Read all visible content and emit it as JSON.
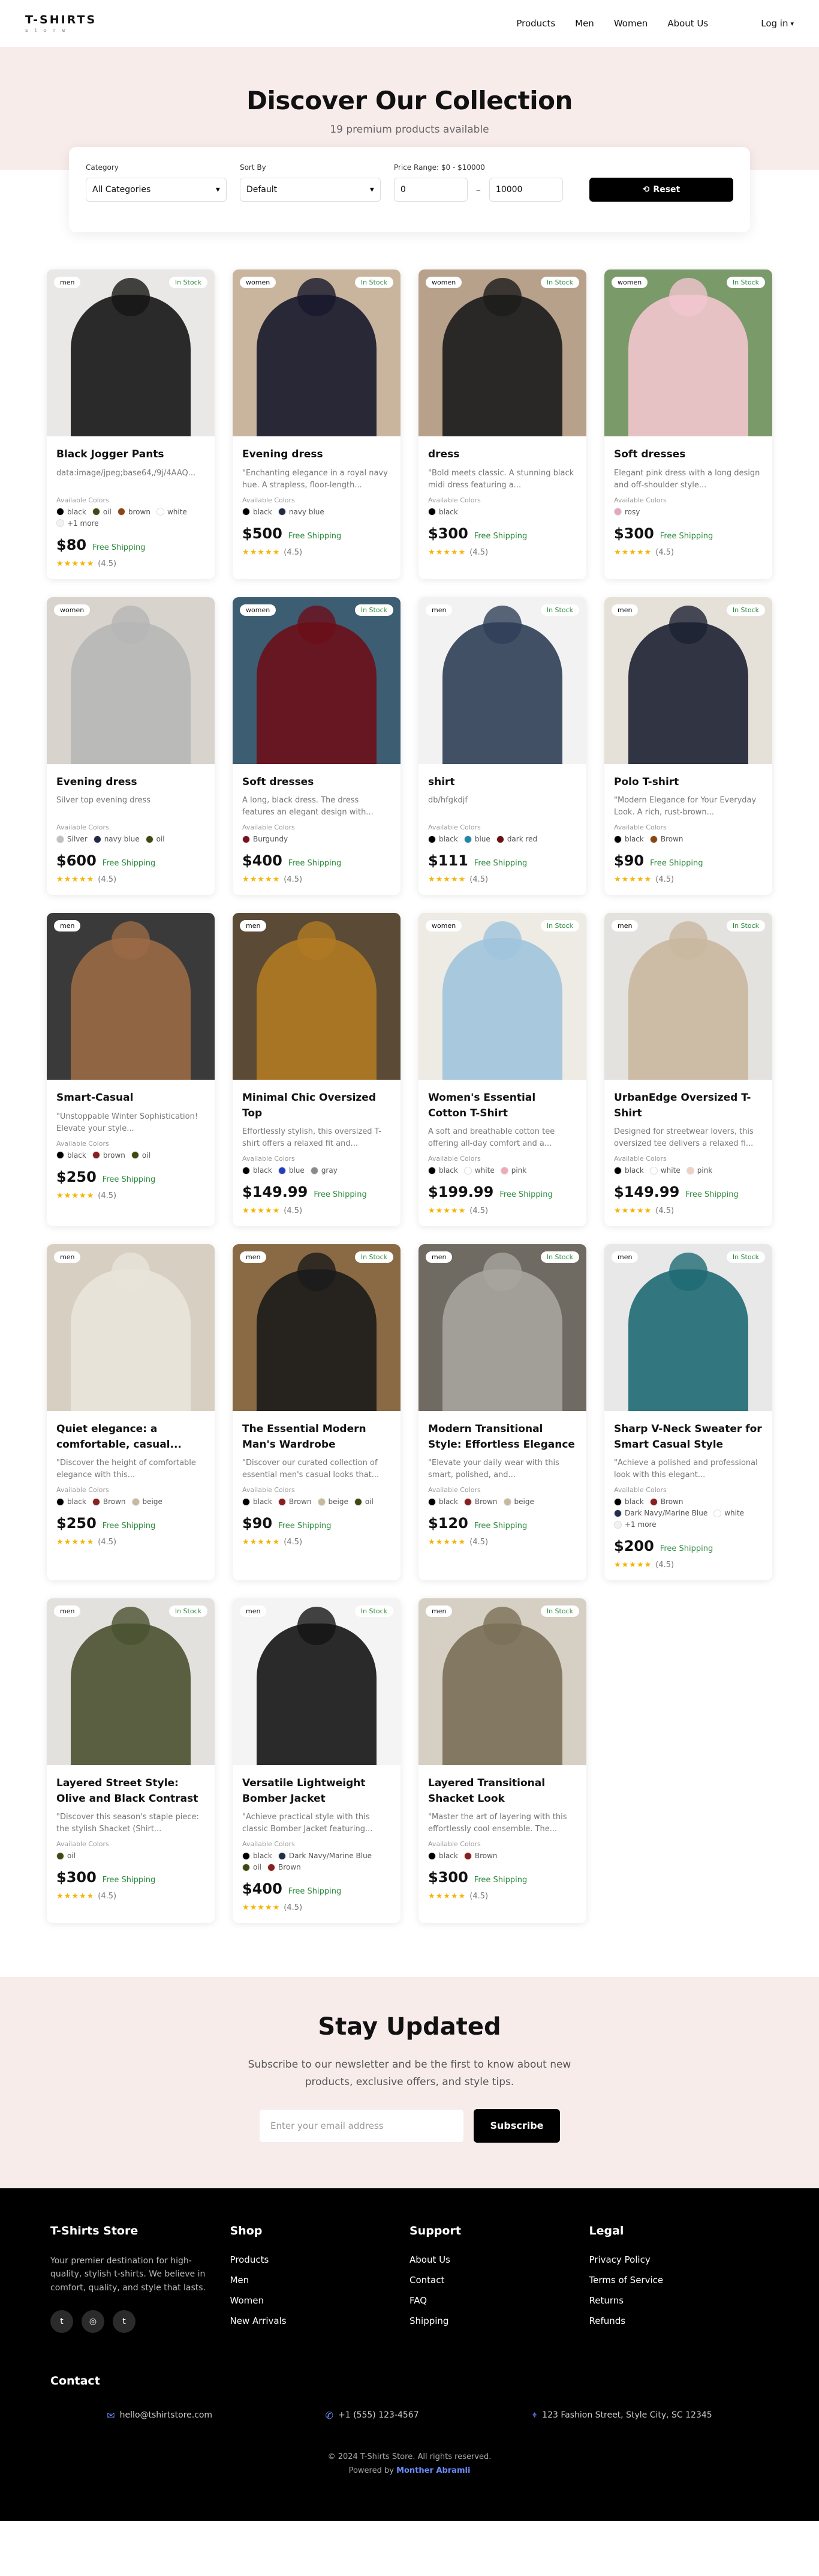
{
  "header": {
    "logo": "T-SHIRTS",
    "logo_sub": "store",
    "nav": [
      "Products",
      "Men",
      "Women",
      "About Us"
    ],
    "login": "Log in"
  },
  "hero": {
    "title": "Discover Our Collection",
    "subtitle": "19 premium products available"
  },
  "filters": {
    "category_label": "Category",
    "category_value": "All Categories",
    "sort_label": "Sort By",
    "sort_value": "Default",
    "price_label": "Price Range: $0 - $10000",
    "price_min": "0",
    "price_max": "10000",
    "reset_label": "Reset"
  },
  "labels": {
    "available_colors": "Available Colors",
    "free_shipping": "Free Shipping",
    "rating": "(4.5)"
  },
  "products": [
    {
      "cat": "men",
      "stock": "In Stock",
      "title": "Black Jogger Pants",
      "desc": "data:image/jpeg;base64,/9j/4AAQ...",
      "colors": [
        [
          "black",
          "#000000"
        ],
        [
          "oil",
          "#3f4a12"
        ],
        [
          "brown",
          "#8b4513"
        ],
        [
          "white",
          "#ffffff"
        ]
      ],
      "more": "+1 more",
      "price": "$80",
      "bg": "#e9e8e6",
      "fg": "#151515"
    },
    {
      "cat": "women",
      "stock": "In Stock",
      "title": "Evening dress",
      "desc": "\"Enchanting elegance in a royal navy hue. A strapless, floor-length...",
      "colors": [
        [
          "black",
          "#000000"
        ],
        [
          "navy blue",
          "#1f2a44"
        ]
      ],
      "price": "$500",
      "bg": "#c9b59d",
      "fg": "#16182c"
    },
    {
      "cat": "women",
      "stock": "In Stock",
      "title": "dress",
      "desc": "\"Bold meets classic. A stunning black midi dress featuring a...",
      "colors": [
        [
          "black",
          "#000000"
        ]
      ],
      "price": "$300",
      "bg": "#b7a18b",
      "fg": "#1b1b1b"
    },
    {
      "cat": "women",
      "stock": "In Stock",
      "title": "Soft dresses",
      "desc": "Elegant pink dress with a long design and off-shoulder style...",
      "colors": [
        [
          "rosy",
          "#e6a5c3"
        ]
      ],
      "price": "$300",
      "bg": "#7a9a6a",
      "fg": "#f3c6cf"
    },
    {
      "cat": "women",
      "stock": "",
      "title": "Evening dress",
      "desc": "Silver top evening dress",
      "colors": [
        [
          "Silver",
          "#c0c0c0"
        ],
        [
          "navy blue",
          "#1f2a44"
        ],
        [
          "oil",
          "#3f4a12"
        ]
      ],
      "price": "$600",
      "bg": "#d8d3cd",
      "fg": "#b7b7b7"
    },
    {
      "cat": "women",
      "stock": "In Stock",
      "title": "Soft dresses",
      "desc": "A long, black dress. The dress features an elegant design with...",
      "colors": [
        [
          "Burgundy",
          "#7a0f1f"
        ]
      ],
      "price": "$400",
      "bg": "#3c5d72",
      "fg": "#6b0f1a"
    },
    {
      "cat": "men",
      "stock": "In Stock",
      "title": "shirt",
      "desc": "db/hfgkdjf",
      "colors": [
        [
          "black",
          "#000000"
        ],
        [
          "blue",
          "#1e88a8"
        ],
        [
          "dark red",
          "#6b0f0f"
        ]
      ],
      "price": "$111",
      "bg": "#f2f2f2",
      "fg": "#2f3e57"
    },
    {
      "cat": "men",
      "stock": "In Stock",
      "title": "Polo T-shirt",
      "desc": "\"Modern Elegance for Your Everyday Look. A rich, rust-brown...",
      "colors": [
        [
          "black",
          "#000000"
        ],
        [
          "Brown",
          "#8b4513"
        ]
      ],
      "price": "$90",
      "bg": "#e6e1d8",
      "fg": "#1d2233"
    },
    {
      "cat": "men",
      "stock": "",
      "title": "Smart-Casual",
      "desc": "\"Unstoppable Winter Sophistication! Elevate your style...",
      "colors": [
        [
          "black",
          "#000000"
        ],
        [
          "brown",
          "#8b1e1e"
        ],
        [
          "oil",
          "#3f4a12"
        ]
      ],
      "price": "$250",
      "bg": "#3a3a3a",
      "fg": "#9a6a45"
    },
    {
      "cat": "men",
      "stock": "",
      "title": "Minimal Chic Oversized Top",
      "desc": "Effortlessly stylish, this oversized T-shirt offers a relaxed fit and...",
      "colors": [
        [
          "black",
          "#000000"
        ],
        [
          "blue",
          "#1f3fbf"
        ],
        [
          "gray",
          "#8a8a8a"
        ]
      ],
      "price": "$149.99",
      "bg": "#5a4a36",
      "fg": "#b07a24"
    },
    {
      "cat": "women",
      "stock": "In Stock",
      "title": "Women's Essential Cotton T-Shirt",
      "desc": "A soft and breathable cotton tee offering all-day comfort and a...",
      "colors": [
        [
          "black",
          "#000000"
        ],
        [
          "white",
          "#ffffff"
        ],
        [
          "pink",
          "#f1a9b7"
        ]
      ],
      "price": "$199.99",
      "bg": "#eeeae4",
      "fg": "#9fc4dc"
    },
    {
      "cat": "men",
      "stock": "In Stock",
      "title": "UrbanEdge Oversized T-Shirt",
      "desc": "Designed for streetwear lovers, this oversized tee delivers a relaxed fi...",
      "colors": [
        [
          "black",
          "#000000"
        ],
        [
          "white",
          "#ffffff"
        ],
        [
          "pink",
          "#f3d0c7"
        ]
      ],
      "price": "$149.99",
      "bg": "#e4e2de",
      "fg": "#c9b8a0"
    },
    {
      "cat": "men",
      "stock": "",
      "title": "Quiet elegance: a comfortable, casual...",
      "desc": "\"Discover the height of comfortable elegance with this...",
      "colors": [
        [
          "black",
          "#000000"
        ],
        [
          "Brown",
          "#8b1e1e"
        ],
        [
          "beige",
          "#c8b99a"
        ]
      ],
      "price": "$250",
      "bg": "#d8cfc3",
      "fg": "#e9e4da"
    },
    {
      "cat": "men",
      "stock": "In Stock",
      "title": "The Essential Modern Man's Wardrobe",
      "desc": "\"Discover our curated collection of essential men's casual looks that...",
      "colors": [
        [
          "black",
          "#000000"
        ],
        [
          "Brown",
          "#8b1e1e"
        ],
        [
          "beige",
          "#c8b99a"
        ],
        [
          "oil",
          "#3f4a12"
        ]
      ],
      "price": "$90",
      "bg": "#8a6a44",
      "fg": "#1b1b1b"
    },
    {
      "cat": "men",
      "stock": "In Stock",
      "title": "Modern Transitional Style: Effortless Elegance",
      "desc": "\"Elevate your daily wear with this smart, polished, and...",
      "colors": [
        [
          "black",
          "#000000"
        ],
        [
          "Brown",
          "#8b1e1e"
        ],
        [
          "beige",
          "#c8b99a"
        ]
      ],
      "price": "$120",
      "bg": "#6f6a62",
      "fg": "#a7a59f"
    },
    {
      "cat": "men",
      "stock": "In Stock",
      "title": "Sharp V-Neck Sweater for Smart Casual Style",
      "desc": "\"Achieve a polished and professional look with this elegant...",
      "colors": [
        [
          "black",
          "#000000"
        ],
        [
          "Brown",
          "#8b1e1e"
        ],
        [
          "Dark Navy/Marine Blue",
          "#1f3048"
        ],
        [
          "white",
          "#ffffff"
        ]
      ],
      "more": "+1 more",
      "price": "$200",
      "bg": "#e8e8e8",
      "fg": "#1e6a73"
    },
    {
      "cat": "men",
      "stock": "In Stock",
      "title": "Layered Street Style: Olive and Black Contrast",
      "desc": "\"Discover this season's staple piece: the stylish Shacket (Shirt...",
      "colors": [
        [
          "oil",
          "#3f4a12"
        ]
      ],
      "price": "$300",
      "bg": "#e3e1dd",
      "fg": "#4a5130"
    },
    {
      "cat": "men",
      "stock": "In Stock",
      "title": "Versatile Lightweight Bomber Jacket",
      "desc": "\"Achieve practical style with this classic Bomber Jacket featuring...",
      "colors": [
        [
          "black",
          "#000000"
        ],
        [
          "Dark Navy/Marine Blue",
          "#1f3048"
        ],
        [
          "oil",
          "#3f4a12"
        ],
        [
          "Brown",
          "#8b1e1e"
        ]
      ],
      "price": "$400",
      "bg": "#f4f4f4",
      "fg": "#141414"
    },
    {
      "cat": "men",
      "stock": "In Stock",
      "title": "Layered Transitional Shacket Look",
      "desc": "\"Master the art of layering with this effortlessly cool ensemble. The...",
      "colors": [
        [
          "black",
          "#000000"
        ],
        [
          "Brown",
          "#8b1e1e"
        ]
      ],
      "price": "$300",
      "bg": "#d6d0c4",
      "fg": "#7a6f58"
    }
  ],
  "newsletter": {
    "title": "Stay Updated",
    "text": "Subscribe to our newsletter and be the first to know about new products, exclusive offers, and style tips.",
    "placeholder": "Enter your email address",
    "button": "Subscribe"
  },
  "footer": {
    "brand": "T-Shirts Store",
    "desc": "Your premier destination for high-quality, stylish t-shirts. We believe in comfort, quality, and style that lasts.",
    "shop_title": "Shop",
    "shop": [
      "Products",
      "Men",
      "Women",
      "New Arrivals"
    ],
    "support_title": "Support",
    "support": [
      "About Us",
      "Contact",
      "FAQ",
      "Shipping"
    ],
    "legal_title": "Legal",
    "legal": [
      "Privacy Policy",
      "Terms of Service",
      "Returns",
      "Refunds"
    ],
    "contact_title": "Contact",
    "email": "hello@tshirtstore.com",
    "phone": "+1 (555) 123-4567",
    "address": "123 Fashion Street, Style City, SC 12345",
    "copyright": "© 2024 T-Shirts Store. All rights reserved.",
    "powered_prefix": "Powered by",
    "powered_name": "Monther Abramli"
  }
}
